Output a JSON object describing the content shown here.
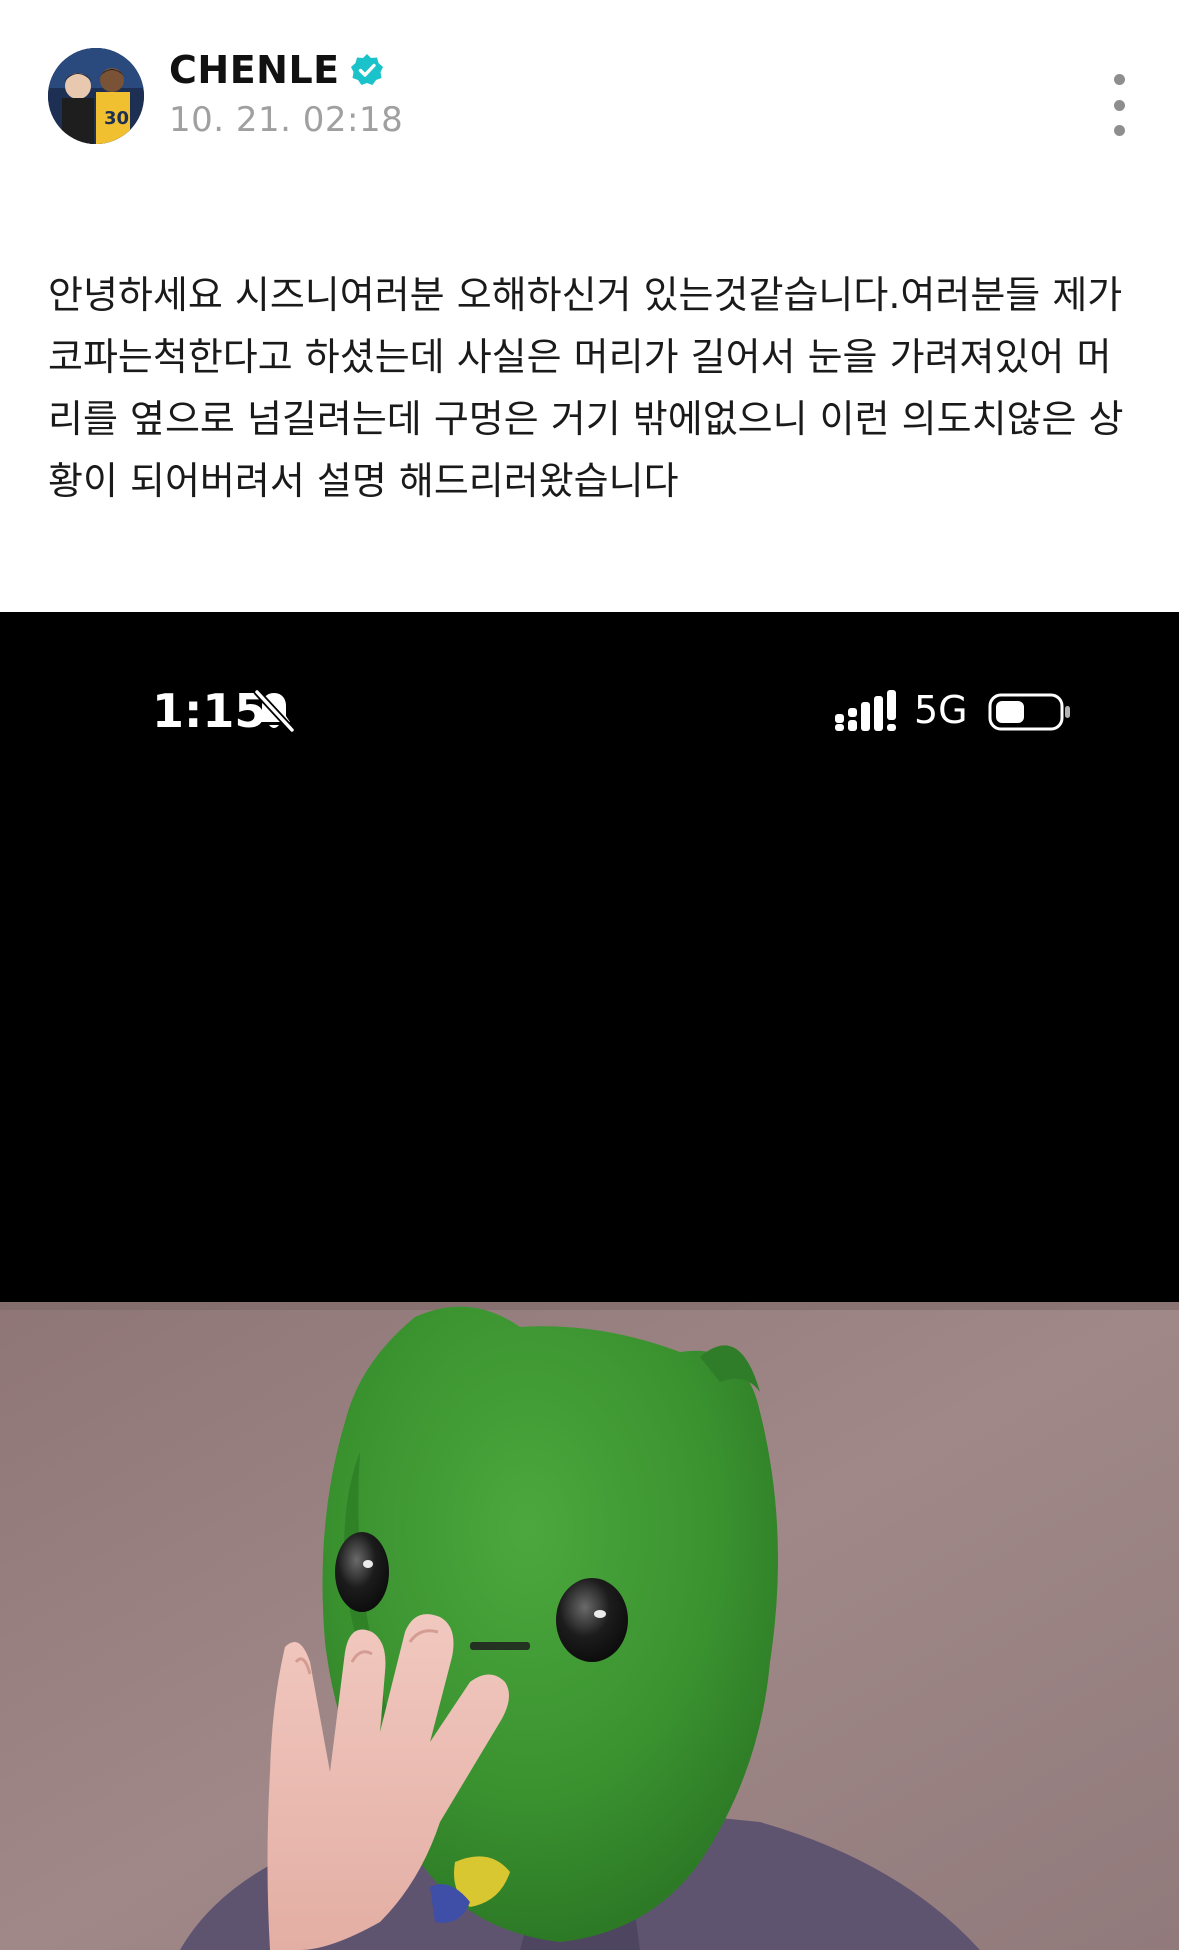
{
  "post": {
    "author": {
      "name": "CHENLE",
      "verified": true,
      "avatar": "profile-photo"
    },
    "timestamp": "10. 21. 02:18",
    "body": "안녕하세요 시즈니여러분 오해하신거 있는것같습니다.여러분들 제가 코파는척한다고 하셨는데 사실은 머리가 길어서 눈을 가려져있어 머리를 옆으로 넘길려는데 구멍은 거기 밖에없으니 이런 의도치않은 상황이 되어버려서 설명 해드리러왔습니다",
    "more_icon": "more-vertical-icon"
  },
  "media": {
    "status_bar": {
      "time": "1:15",
      "silent_icon": "bell-slash-icon",
      "signal_icon": "cellular-signal-icon",
      "network": "5G",
      "battery_icon": "battery-icon"
    },
    "video_frame": "person-in-green-mask-image"
  },
  "colors": {
    "verified_badge": "#19c3c9",
    "timestamp": "#a0a0a0",
    "mask_green": "#3d9a32",
    "background_wall": "#9c8585"
  }
}
